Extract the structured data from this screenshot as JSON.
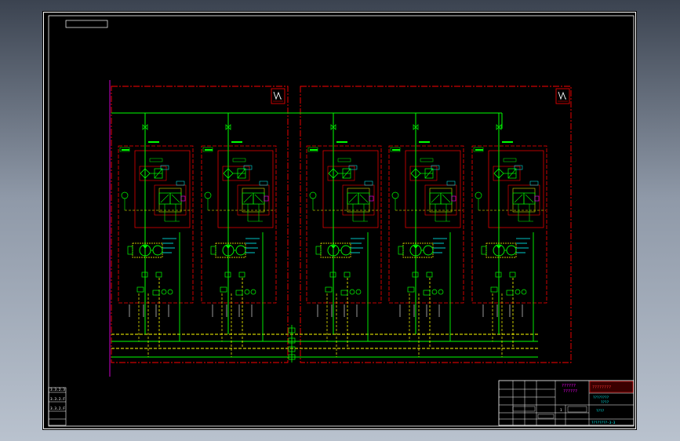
{
  "drawing": {
    "side_labels": [
      "3.3.2.3",
      "3.3.2.F",
      "3.3.2.F"
    ],
    "cabinet_icon": "valve-cabinet-icon",
    "title_block": {
      "project_line1": "??????",
      "project_line2": "??????",
      "company": "????????",
      "drawing_name_line1": "????????",
      "drawing_name_line2": "????",
      "stage": "????",
      "drawing_number": "????????-3-3",
      "sheet_marker": "1"
    },
    "colors": {
      "background": "#000000",
      "frame": "#ffffff",
      "pipe": "#00ff00",
      "signal": "#ffff00",
      "boundary": "#ff0000",
      "component": "#00ff00",
      "label": "#00ffff",
      "accent": "#ff00ff"
    }
  }
}
